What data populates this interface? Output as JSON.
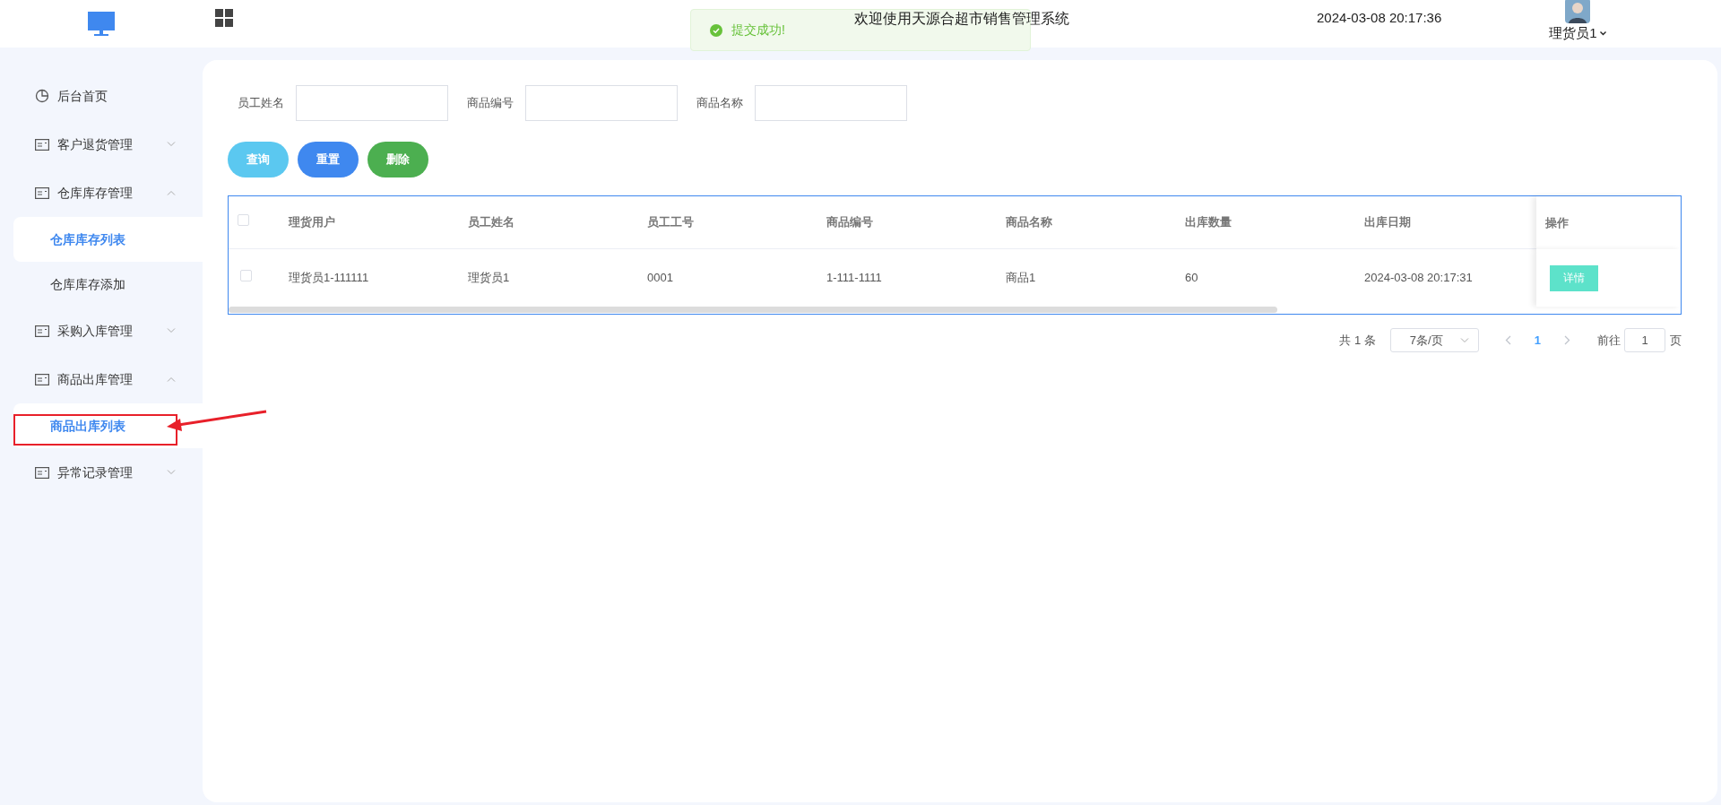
{
  "header": {
    "title": "欢迎使用天源合超市销售管理系统",
    "datetime": "2024-03-08 20:17:36",
    "user": "理货员1"
  },
  "toast": {
    "kind": "success",
    "message": "提交成功!"
  },
  "sidebar": {
    "items": [
      {
        "kind": "link",
        "label": "后台首页"
      },
      {
        "kind": "group",
        "label": "客户退货管理",
        "expanded": false
      },
      {
        "kind": "group",
        "label": "仓库库存管理",
        "expanded": true,
        "children": [
          {
            "label": "仓库库存列表",
            "selected": true
          },
          {
            "label": "仓库库存添加",
            "selected": false
          }
        ]
      },
      {
        "kind": "group",
        "label": "采购入库管理",
        "expanded": false
      },
      {
        "kind": "group",
        "label": "商品出库管理",
        "expanded": true,
        "children": [
          {
            "label": "商品出库列表",
            "selected": true,
            "highlighted": true
          }
        ]
      },
      {
        "kind": "group",
        "label": "异常记录管理",
        "expanded": false
      }
    ]
  },
  "filters": [
    {
      "label": "员工姓名"
    },
    {
      "label": "商品编号"
    },
    {
      "label": "商品名称"
    }
  ],
  "buttons": [
    {
      "label": "查询",
      "color": "#5bc8f0"
    },
    {
      "label": "重置",
      "color": "#3f88ef"
    },
    {
      "label": "删除",
      "color": "#4caf50"
    }
  ],
  "table": {
    "all_checked": false,
    "columns": [
      "理货用户",
      "员工姓名",
      "员工工号",
      "商品编号",
      "商品名称",
      "出库数量",
      "出库日期",
      "操作"
    ],
    "rows": [
      {
        "checked": false,
        "cells": [
          "理货员1-111111",
          "理货员1",
          "0001",
          "1-111-1111",
          "商品1",
          "60",
          "2024-03-08 20:17:31"
        ],
        "action": "详情"
      }
    ]
  },
  "pagination": {
    "total": "共 1 条",
    "page_size": "7条/页",
    "pages": [
      {
        "label": "1",
        "selected": true
      }
    ],
    "goto_label": "前往",
    "goto_value": "1",
    "page_suffix": "页"
  }
}
